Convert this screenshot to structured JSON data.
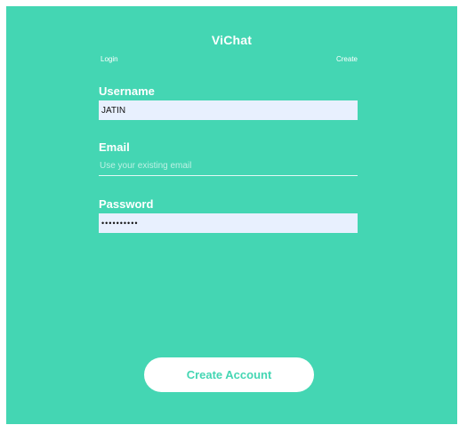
{
  "app": {
    "title": "ViChat",
    "accent_color": "#44d6b3"
  },
  "tabs": {
    "login": "Login",
    "create": "Create"
  },
  "form": {
    "username": {
      "label": "Username",
      "value": "JATIN"
    },
    "email": {
      "label": "Email",
      "value": "",
      "placeholder": "Use your existing email"
    },
    "password": {
      "label": "Password",
      "value": "••••••••••"
    }
  },
  "actions": {
    "create_account": "Create Account"
  }
}
